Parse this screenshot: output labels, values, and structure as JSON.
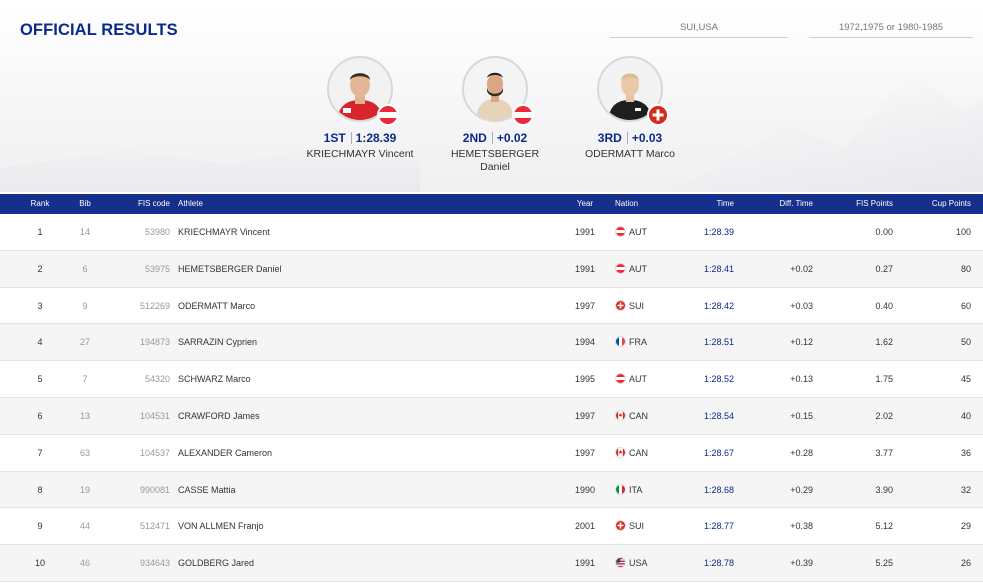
{
  "header": {
    "title": "OFFICIAL RESULTS",
    "filter_nations": "SUI,USA",
    "filter_years": "1972,1975 or 1980-1985"
  },
  "podium": [
    {
      "place": "1ST",
      "value": "1:28.39",
      "name": "KRIECHMAYR Vincent",
      "nation": "AUT",
      "flag_icon": "austria-flag-icon"
    },
    {
      "place": "2ND",
      "value": "+0.02",
      "name": "HEMETSBERGER Daniel",
      "nation": "AUT",
      "flag_icon": "austria-flag-icon"
    },
    {
      "place": "3RD",
      "value": "+0.03",
      "name": "ODERMATT Marco",
      "nation": "SUI",
      "flag_icon": "switzerland-flag-icon"
    }
  ],
  "table": {
    "columns": {
      "rank": "Rank",
      "bib": "Bib",
      "fis_code": "FIS code",
      "athlete": "Athlete",
      "year": "Year",
      "nation": "Nation",
      "time": "Time",
      "diff": "Diff. Time",
      "fis_points": "FIS Points",
      "cup_points": "Cup Points"
    },
    "rows": [
      {
        "rank": "1",
        "bib": "14",
        "fis_code": "53980",
        "athlete": "KRIECHMAYR Vincent",
        "year": "1991",
        "nation": "AUT",
        "time": "1:28.39",
        "diff": "",
        "fis_points": "0.00",
        "cup_points": "100"
      },
      {
        "rank": "2",
        "bib": "6",
        "fis_code": "53975",
        "athlete": "HEMETSBERGER Daniel",
        "year": "1991",
        "nation": "AUT",
        "time": "1:28.41",
        "diff": "+0.02",
        "fis_points": "0.27",
        "cup_points": "80"
      },
      {
        "rank": "3",
        "bib": "9",
        "fis_code": "512269",
        "athlete": "ODERMATT Marco",
        "year": "1997",
        "nation": "SUI",
        "time": "1:28.42",
        "diff": "+0.03",
        "fis_points": "0.40",
        "cup_points": "60"
      },
      {
        "rank": "4",
        "bib": "27",
        "fis_code": "194873",
        "athlete": "SARRAZIN Cyprien",
        "year": "1994",
        "nation": "FRA",
        "time": "1:28.51",
        "diff": "+0.12",
        "fis_points": "1.62",
        "cup_points": "50"
      },
      {
        "rank": "5",
        "bib": "7",
        "fis_code": "54320",
        "athlete": "SCHWARZ Marco",
        "year": "1995",
        "nation": "AUT",
        "time": "1:28.52",
        "diff": "+0.13",
        "fis_points": "1.75",
        "cup_points": "45"
      },
      {
        "rank": "6",
        "bib": "13",
        "fis_code": "104531",
        "athlete": "CRAWFORD James",
        "year": "1997",
        "nation": "CAN",
        "time": "1:28.54",
        "diff": "+0.15",
        "fis_points": "2.02",
        "cup_points": "40"
      },
      {
        "rank": "7",
        "bib": "63",
        "fis_code": "104537",
        "athlete": "ALEXANDER Cameron",
        "year": "1997",
        "nation": "CAN",
        "time": "1:28.67",
        "diff": "+0.28",
        "fis_points": "3.77",
        "cup_points": "36"
      },
      {
        "rank": "8",
        "bib": "19",
        "fis_code": "990081",
        "athlete": "CASSE Mattia",
        "year": "1990",
        "nation": "ITA",
        "time": "1:28.68",
        "diff": "+0.29",
        "fis_points": "3.90",
        "cup_points": "32"
      },
      {
        "rank": "9",
        "bib": "44",
        "fis_code": "512471",
        "athlete": "VON ALLMEN Franjo",
        "year": "2001",
        "nation": "SUI",
        "time": "1:28.77",
        "diff": "+0.38",
        "fis_points": "5.12",
        "cup_points": "29"
      },
      {
        "rank": "10",
        "bib": "46",
        "fis_code": "934643",
        "athlete": "GOLDBERG Jared",
        "year": "1991",
        "nation": "USA",
        "time": "1:28.78",
        "diff": "+0.39",
        "fis_points": "5.25",
        "cup_points": "26"
      }
    ]
  },
  "colors": {
    "header_bg": "#142f8c",
    "title": "#0a2a8a",
    "time": "#0a2a8a"
  }
}
